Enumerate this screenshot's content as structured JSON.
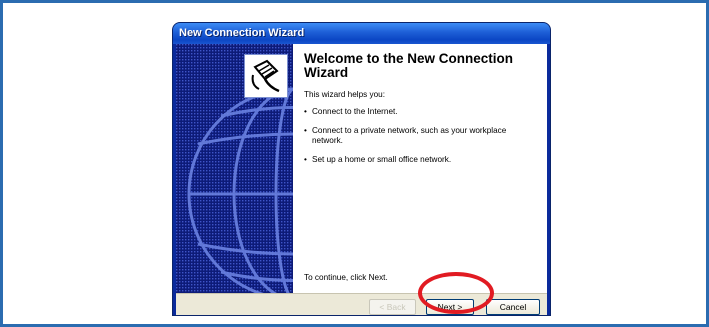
{
  "window": {
    "title": "New Connection Wizard"
  },
  "wizard": {
    "heading": "Welcome to the New Connection Wizard",
    "intro": "This wizard helps you:",
    "bullets": [
      "Connect to the Internet.",
      "Connect to a private network, such as your workplace network.",
      "Set up a home or small office network."
    ],
    "continue_text": "To continue, click Next."
  },
  "buttons": {
    "back": "< Back",
    "next": "Next >",
    "cancel": "Cancel"
  },
  "colors": {
    "frame_border": "#2b6cb0",
    "sidebar": "#0d1b78",
    "highlight": "#e11b22"
  },
  "icons": {
    "wizard_icon": "phone-plug-icon",
    "background": "globe-graphic"
  }
}
